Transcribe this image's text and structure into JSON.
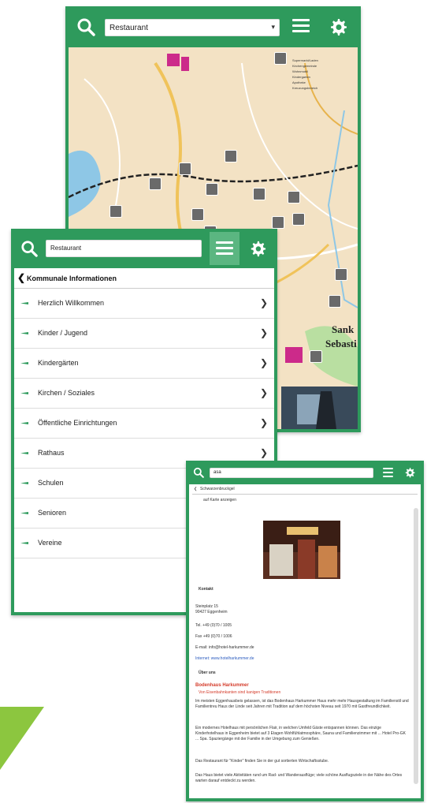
{
  "map_screen": {
    "search_value": "Restaurant",
    "legend_items": [
      "Supermarkt/Laden",
      "Kirchengemeinde",
      "Wohnmobil",
      "Kindergarten",
      "Apotheke",
      "Kreuzungsbereich"
    ],
    "place_label_1": "Sank",
    "place_label_2": "Sebasti"
  },
  "list_screen": {
    "search_value": "Restaurant",
    "header_title": "Kommunale Informationen",
    "items": [
      {
        "label": "Herzlich Willkommen"
      },
      {
        "label": "Kinder / Jugend"
      },
      {
        "label": "Kindergärten"
      },
      {
        "label": "Kirchen / Soziales"
      },
      {
        "label": "Öffentliche Einrichtungen"
      },
      {
        "label": "Rathaus"
      },
      {
        "label": "Schulen"
      },
      {
        "label": "Senioren"
      },
      {
        "label": "Vereine"
      }
    ]
  },
  "detail_screen": {
    "search_value": "asa",
    "breadcrumb": "Schwarzenbruckgel",
    "sub_breadcrumb": "auf Karte anzeigen",
    "contact_heading": "Kontakt",
    "contact_lines": [
      "Steinplatz 15",
      "90427 Eggenheim",
      "Tel. +49 (0)70 / 1005",
      "Fax +49 (0)70 / 1006"
    ],
    "email_line": "E-mail: info@hotel-harkummer.de",
    "web_line": "Internet: www.hotelharkummer.de",
    "about_heading": "Über uns",
    "title_red": "Bodenhaus Harkummer",
    "subtitle_red": "Von Eisenbahnkanten sind kanigen Traditionen",
    "para_1": "Im meisten Eggenhausbeis gelassen, ist das Bodenhaus Harkummer Haus mehr mehr Hausgestaltung im Familienstil und Familientreu Haus der Linde seit Jahren mit Tradition auf dem höchsten Niveau seit 1970 mit Gastfreundlichkeit.",
    "para_2": "Ein modernes Hotelhaus mit persönlichen Flair, in welchen Umfeld Gäste entspannen können. Das einzige Kinderhotelhaus in Eggenheim bietet auf 3 Etagen Wohlfühlatmosphäre, Sauna und Familienzimmer mit ... Hotel Pro-GK ... Spa. Spaziergänge mit der Familie in der Umgebung zum Genießen.",
    "para_3": "Das Restaurant für \"Kinder\" finden Sie in der gut sortierten Wirtschaftsstube.",
    "para_4": "Das Haus bietet viele Aktivitäten rund um Rad- und Wanderausflüge; viele schöne Ausflugsziele in der Nähe des Ortes warten darauf entdeckt zu werden."
  },
  "colors": {
    "brand_green": "#2e9a5c",
    "accent_red": "#d43b2a",
    "link_blue": "#2a5bbf"
  }
}
